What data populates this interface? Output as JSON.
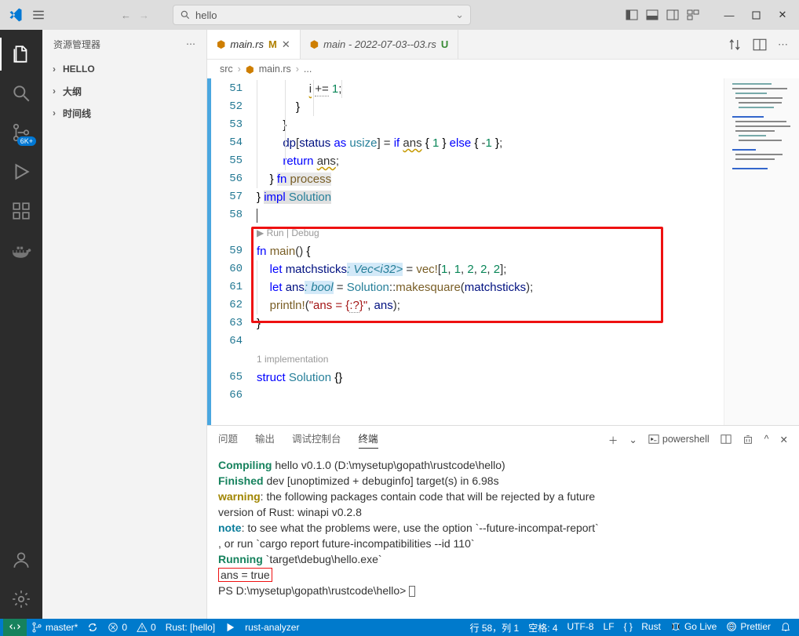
{
  "search": {
    "placeholder": "hello"
  },
  "sidebar": {
    "title": "资源管理器",
    "sections": [
      "HELLO",
      "大纲",
      "时间线"
    ]
  },
  "activity": {
    "badge": "6K+"
  },
  "tabs": [
    {
      "icon": "rust",
      "name": "main.rs",
      "marker": "M",
      "close": true
    },
    {
      "icon": "rust",
      "name": "main - 2022-07-03--03.rs",
      "marker": "U",
      "close": false
    }
  ],
  "breadcrumb": {
    "seg1": "src",
    "seg2": "main.rs",
    "seg3": "..."
  },
  "editor": {
    "codelens_run_debug": "▶ Run | Debug",
    "codelens_impl": "1 implementation",
    "lines": {
      "51": "                i += 1;",
      "52": "            }",
      "53": "        }",
      "54": "        dp[status as usize] = if ans { 1 } else { -1 };",
      "55": "        return ans;",
      "56": "    } fn process",
      "57": "} impl Solution",
      "58": "",
      "59": "fn main() {",
      "60": "    let matchsticks: Vec<i32> = vec![1, 1, 2, 2, 2];",
      "61": "    let ans: bool = Solution::makesquare(matchsticks);",
      "62": "    println!(\"ans = {:?}\", ans);",
      "63": "}",
      "64": "",
      "65": "struct Solution {}",
      "66": ""
    },
    "line_numbers": [
      "51",
      "52",
      "53",
      "54",
      "55",
      "56",
      "57",
      "58",
      "",
      "59",
      "60",
      "61",
      "62",
      "63",
      "64",
      "",
      "65",
      "66"
    ]
  },
  "panel": {
    "tabs": [
      "问题",
      "输出",
      "调试控制台",
      "终端"
    ],
    "shell": "powershell",
    "lines": [
      {
        "pre": "   ",
        "strong": "Compiling",
        "rest": " hello v0.1.0 (D:\\mysetup\\gopath\\rustcode\\hello)"
      },
      {
        "pre": "    ",
        "strong": "Finished",
        "rest": " dev [unoptimized + debuginfo] target(s) in 6.98s"
      },
      {
        "warn": "warning",
        "rest": ": the following packages contain code that will be rejected by a future"
      },
      {
        "plain": "version of Rust: winapi v0.2.8"
      },
      {
        "note": "note",
        "rest": ": to see what the problems were, use the option `--future-incompat-report`"
      },
      {
        "plain": ", or run `cargo report future-incompatibilities --id 110`"
      },
      {
        "pre": "     ",
        "strong": "Running",
        "rest": " `target\\debug\\hello.exe`"
      },
      {
        "hl": "ans = true"
      },
      {
        "prompt": "PS D:\\mysetup\\gopath\\rustcode\\hello> "
      }
    ]
  },
  "status": {
    "branch": "master*",
    "errors": "0",
    "warnings": "0",
    "rust_proj": "Rust: [hello]",
    "analyzer": "rust-analyzer",
    "pos": "行 58，列 1",
    "spaces": "空格: 4",
    "enc": "UTF-8",
    "eol": "LF",
    "lang": "Rust",
    "golive": "Go Live",
    "prettier": "Prettier"
  }
}
